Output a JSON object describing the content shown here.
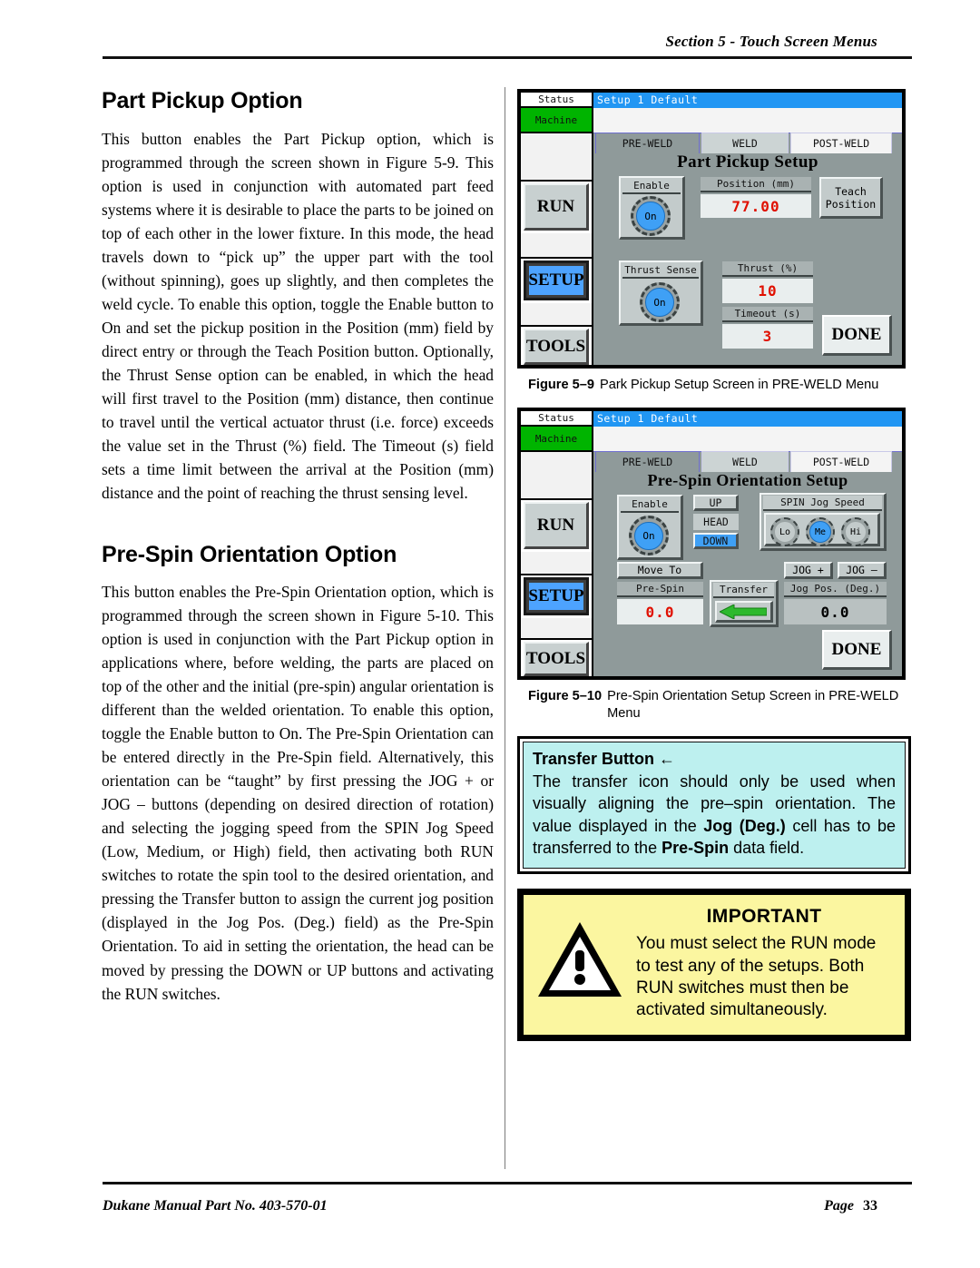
{
  "header": {
    "section": "Section 5 - Touch Screen Menus"
  },
  "footer": {
    "manual": "Dukane Manual Part No. 403-570-01",
    "page_label": "Page",
    "page_number": "33"
  },
  "left_column": {
    "heading1": "Part Pickup Option",
    "para1": "This button enables the Part Pickup option, which is programmed through the screen shown in Figure 5-9.  This option is used in conjunction with automated part feed systems where it is desirable to place the parts to be joined on top of each other in the lower fixture. In this mode, the head travels down to “pick up” the upper part with the tool (without spinning), goes up slightly, and then completes the weld cycle. To enable this option, toggle the Enable button to On and set the pickup position in the Position (mm) field by direct entry or through the Teach Position button.  Optionally, the Thrust Sense option can be enabled, in which the head will first travel to the Position (mm) distance, then continue to travel until the vertical actuator thrust (i.e. force) exceeds the value set in the Thrust (%) field. The Timeout (s) field sets a time limit between the arrival at the Position (mm) distance and the point of reaching the thrust sensing level.",
    "heading2": "Pre-Spin Orientation Option",
    "para2": "This button enables the Pre-Spin Orientation option, which is programmed through the screen shown in Figure 5-10. This option is used in conjunction with the Part Pickup option in applications where, before welding, the parts are placed on top of the other and the initial (pre-spin) angular orientation is different than the welded orientation.  To enable this option, toggle the Enable button to On. The Pre-Spin Orientation can be entered directly in the Pre-Spin field. Alternatively, this orientation can be “taught” by first pressing the JOG + or JOG – buttons (depending on desired direction of rotation) and selecting the jogging speed from the SPIN Jog Speed (Low, Medium, or High) field, then activating both RUN switches to rotate the spin tool to the desired orientation, and pressing the Transfer button to assign the current jog position (displayed in the Jog Pos. (Deg.) field) as the Pre-Spin Orientation. To aid in setting the orientation, the head can be moved by pressing the DOWN or UP buttons and activating the RUN switches."
  },
  "figure1": {
    "caption_label": "Figure 5–9",
    "caption_text": "Park Pickup Setup Screen in PRE-WELD Menu",
    "screen": {
      "sidebar": {
        "status_label": "Status",
        "machine_label": "Machine",
        "run_label": "RUN",
        "setup_label": "SETUP",
        "tools_label": "TOOLS",
        "selected": "SETUP",
        "machine_color": "#00b400"
      },
      "titlebar": "Setup 1   Default",
      "tabs": [
        {
          "label": "PRE-WELD",
          "active": true
        },
        {
          "label": "WELD",
          "active": false
        },
        {
          "label": "POST-WELD",
          "active": false
        }
      ],
      "title": "Part Pickup Setup",
      "enable": {
        "label": "Enable",
        "state": "On"
      },
      "position": {
        "label": "Position (mm)",
        "value": "77.00"
      },
      "teach": {
        "line1": "Teach",
        "line2": "Position"
      },
      "thrust_sense": {
        "label": "Thrust Sense",
        "state": "On"
      },
      "thrust": {
        "label": "Thrust (%)",
        "value": "10"
      },
      "timeout": {
        "label": "Timeout (s)",
        "value": "3"
      },
      "done_label": "DONE"
    }
  },
  "figure2": {
    "caption_label": "Figure 5–10",
    "caption_text": "Pre-Spin Orientation Setup Screen in PRE-WELD Menu",
    "screen": {
      "sidebar": {
        "status_label": "Status",
        "machine_label": "Machine",
        "run_label": "RUN",
        "setup_label": "SETUP",
        "tools_label": "TOOLS",
        "selected": "SETUP",
        "machine_color": "#00b400"
      },
      "titlebar": "Setup 1   Default",
      "tabs": [
        {
          "label": "PRE-WELD",
          "active": true
        },
        {
          "label": "WELD",
          "active": false
        },
        {
          "label": "POST-WELD",
          "active": false
        }
      ],
      "title": "Pre-Spin Orientation Setup",
      "enable": {
        "label": "Enable",
        "state": "On"
      },
      "head": {
        "up_label": "UP",
        "head_label": "HEAD",
        "down_label": "DOWN",
        "down_active": true
      },
      "spin_jog_speed": {
        "label": "SPIN Jog Speed",
        "options": [
          {
            "label": "Lo",
            "selected": false
          },
          {
            "label": "Me",
            "selected": true
          },
          {
            "label": "Hi",
            "selected": false
          }
        ]
      },
      "move_to_label": "Move To",
      "prespin": {
        "label": "Pre-Spin",
        "value": "0.0"
      },
      "transfer": {
        "label": "Transfer",
        "icon": "left-arrow-icon",
        "color": "#2db92d"
      },
      "jog_plus_label": "JOG +",
      "jog_minus_label": "JOG –",
      "jog_pos": {
        "label": "Jog Pos. (Deg.)",
        "value": "0.0"
      },
      "done_label": "DONE"
    }
  },
  "transfer_note": {
    "title": "Transfer Button ←",
    "body_part1": "The transfer icon should only be used when visually aligning the pre–spin orientation. The value displayed in the ",
    "bold1": "Jog (Deg.)",
    "body_part2": " cell has to be transferred to the ",
    "bold2": "Pre-Spin",
    "body_part3": " data field.",
    "bg_color": "#bdf0ef"
  },
  "important_note": {
    "title": "IMPORTANT",
    "text": "You must select the RUN mode to test any of the setups. Both RUN switches must then be activated simultaneously.",
    "icon": "warning-triangle-icon",
    "bg_color": "#fbf6a0"
  }
}
